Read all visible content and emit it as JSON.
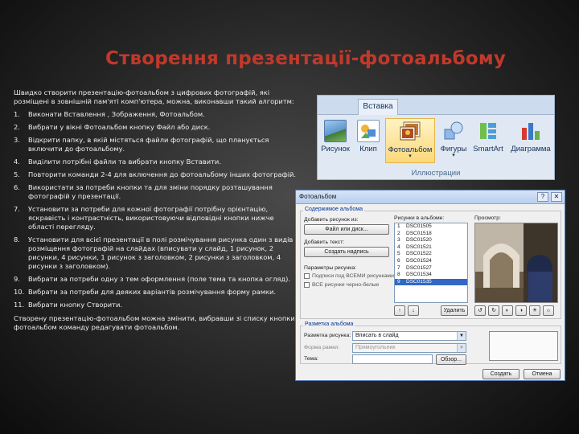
{
  "slide": {
    "title": "Створення презентації-фотоальбому",
    "intro": "Швидко створити презентацію-фотоальбом з цифрових фотографій, які розміщені в зовнішній пам'яті комп'ютера, можна, виконавши такий алгоритм:",
    "steps": [
      {
        "num": "1.",
        "text": "Виконати Вставлення , Зображення, Фотоальбом."
      },
      {
        "num": "2.",
        "text": "Вибрати у вікні Фотоальбом кнопку Файл або диск."
      },
      {
        "num": "3.",
        "text": "Відкрити папку, в якій містяться файли фотографій, що планується включити до фотоальбому."
      },
      {
        "num": "4.",
        "text": "Виділити потрібні файли та вибрати кнопку Вставити."
      },
      {
        "num": "5.",
        "text": "Повторити команди 2-4 для включення до фотоальбому інших фотографій."
      },
      {
        "num": "6.",
        "text": "Використати за потреби кнопки та для зміни порядку розташування фотографій у презентації."
      },
      {
        "num": "7.",
        "text": "Установити за потреби для кожної фотографії потрібну орієнтацію, яскравість і контрастність, використовуючи відповідні кнопки нижче області перегляду."
      },
      {
        "num": "8.",
        "text": "Установити для всієї презентації в полі розмічування рисунка один з видів розміщення фотографій на слайдах (вписувати у слайд, 1 рисунок, 2 рисунки, 4 рисунки, 1 рисунок з заголовком, 2 рисунки з заголовком, 4 рисунки з заголовком)."
      },
      {
        "num": "9.",
        "text": "Вибрати за потреби одну з тем оформлення (поле тема та кнопка огляд)."
      },
      {
        "num": "10.",
        "text": "Вибрати за потреби для деяких варіантів розмічування форму рамки."
      },
      {
        "num": "11.",
        "text": "Вибрати кнопку Створити."
      }
    ],
    "outro": "Створену презентацію-фотоальбом можна змінити, вибравши зі списку кнопки фотоальбом команду редагувати фотоальбом."
  },
  "ribbon": {
    "tab": "Вставка",
    "buttons": {
      "picture": "Рисунок",
      "clip": "Клип",
      "photoalbum": "Фотоальбом",
      "shapes": "Фигуры",
      "smartart": "SmartArt",
      "chart": "Диаграмма"
    },
    "group": "Иллюстрации"
  },
  "dialog": {
    "title": "Фотоальбом",
    "help": "?",
    "close": "✕",
    "section_album_content": "Содержимое альбома",
    "insert_from": "Добавить рисунок из:",
    "file_disk_button": "Файл или диск...",
    "insert_text": "Добавить текст:",
    "new_text_button": "Создать надпись",
    "picture_options": "Параметры рисунка:",
    "option_captions": "Подписи под ВСЕМИ рисунками",
    "option_bw": "ВСЕ рисунки черно-белые",
    "pictures_in_album": "Рисунки в альбоме:",
    "files": [
      {
        "n": "1",
        "name": "DSC01505"
      },
      {
        "n": "2",
        "name": "DSC01518"
      },
      {
        "n": "3",
        "name": "DSC01520"
      },
      {
        "n": "4",
        "name": "DSC01521"
      },
      {
        "n": "5",
        "name": "DSC01522"
      },
      {
        "n": "6",
        "name": "DSC01524"
      },
      {
        "n": "7",
        "name": "DSC01527"
      },
      {
        "n": "8",
        "name": "DSC01534"
      },
      {
        "n": "9",
        "name": "DSC01535"
      }
    ],
    "selected_index": 8,
    "preview_label": "Просмотр:",
    "remove_button": "Удалить",
    "section_layout": "Разметка альбома",
    "picture_layout_label": "Разметка рисунка:",
    "picture_layout_value": "Вписать в слайд",
    "frame_shape_label": "Форма рамки:",
    "frame_shape_value": "Прямоугольник",
    "theme_label": "Тема:",
    "browse_button": "Обзор...",
    "create_button": "Создать",
    "cancel_button": "Отмена"
  }
}
